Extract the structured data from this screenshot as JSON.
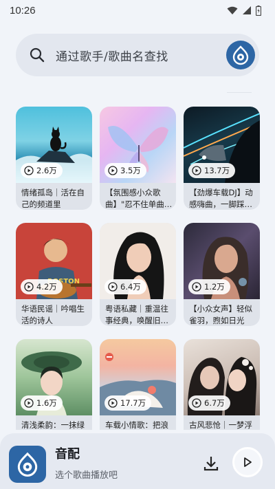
{
  "status": {
    "time": "10:26"
  },
  "search": {
    "placeholder": "通过歌手/歌曲名查找"
  },
  "playlists": [
    {
      "plays": "2.6万",
      "title": "情绪孤岛｜活在自己的频道里",
      "art": "cat-ocean-icon"
    },
    {
      "plays": "3.5万",
      "title": "【氛围感小众歌曲】\"忍不住单曲…",
      "art": "butterfly-icon"
    },
    {
      "plays": "13.7万",
      "title": "【劲爆车载DJ】动感嗨曲，一脚踩…",
      "art": "car-night-icon"
    },
    {
      "plays": "4.2万",
      "title": "华语民谣｜吟唱生活的诗人",
      "art": "guitar-player-icon"
    },
    {
      "plays": "6.4万",
      "title": "粤语私藏｜重温往事经典，唤醒旧…",
      "art": "portrait-icon"
    },
    {
      "plays": "1.2万",
      "title": "【小众女声】轻似雀羽，煦如日光",
      "art": "portrait-icon"
    },
    {
      "plays": "1.6万",
      "title": "清浅柔韵：一抹绿影锁那块",
      "art": "portrait-icon"
    },
    {
      "plays": "17.7万",
      "title": "车载小情歌：把浪漫装进车里",
      "art": "car-window-icon"
    },
    {
      "plays": "6.7万",
      "title": "古风悲怆｜一梦浮生，相思寄明月",
      "art": "couple-icon"
    }
  ],
  "player": {
    "title": "音配",
    "subtitle": "选个歌曲播放吧"
  },
  "colors": {
    "accent": "#2d66a5",
    "background": "#f1f4f9",
    "card": "#dfe3ea"
  }
}
